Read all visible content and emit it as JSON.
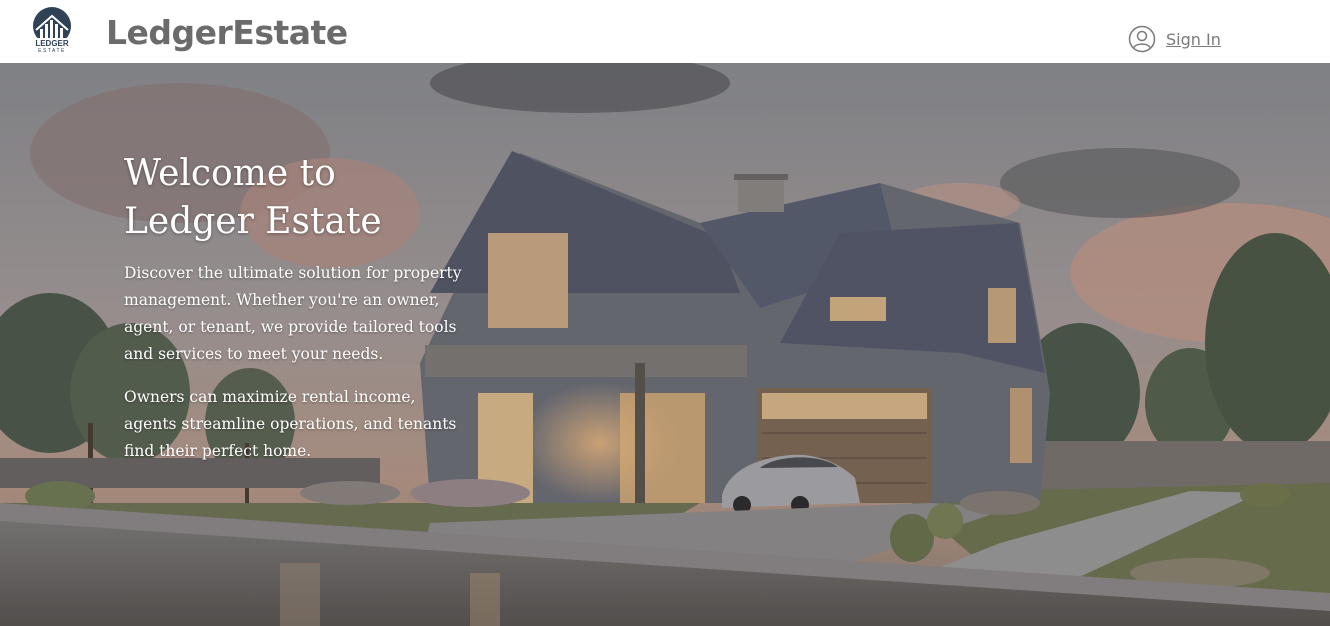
{
  "header": {
    "logo_text_top": "LEDGER",
    "logo_text_bottom": "ESTATE",
    "brand": "LedgerEstate",
    "sign_in_label": "Sign In",
    "sign_in_icon": "user-circle-icon"
  },
  "hero": {
    "title": "Welcome to Ledger Estate",
    "paragraph_1": "Discover the ultimate solution for property management. Whether you're an owner, agent, or tenant, we provide tailored tools and services to meet your needs.",
    "paragraph_2": "Owners can maximize rental income, agents streamline operations, and tenants find their perfect home."
  },
  "colors": {
    "brand_text": "#6b6b6b",
    "link_text": "#7a7a7a",
    "hero_text": "#ffffff"
  }
}
